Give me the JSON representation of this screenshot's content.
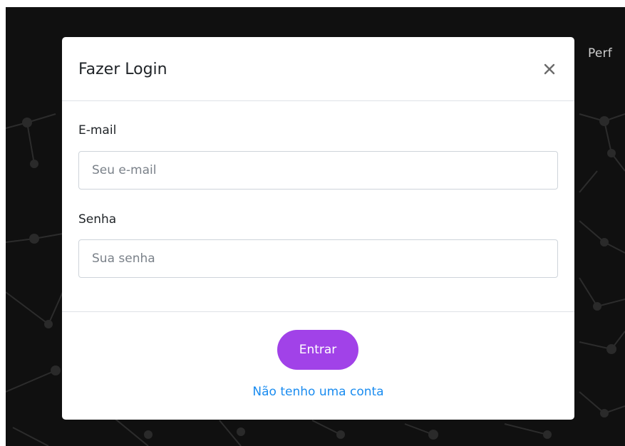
{
  "background": {
    "color": "#101010",
    "nav_link": "Perf"
  },
  "modal": {
    "title": "Fazer Login",
    "close_icon": "close-icon",
    "form": {
      "email": {
        "label": "E-mail",
        "placeholder": "Seu e-mail",
        "value": ""
      },
      "password": {
        "label": "Senha",
        "placeholder": "Sua senha",
        "value": ""
      }
    },
    "footer": {
      "submit_label": "Entrar",
      "register_link": "Não tenho uma conta"
    }
  },
  "colors": {
    "accent": "#a142e8",
    "link": "#1a8cf0",
    "border": "#dee2e6"
  }
}
